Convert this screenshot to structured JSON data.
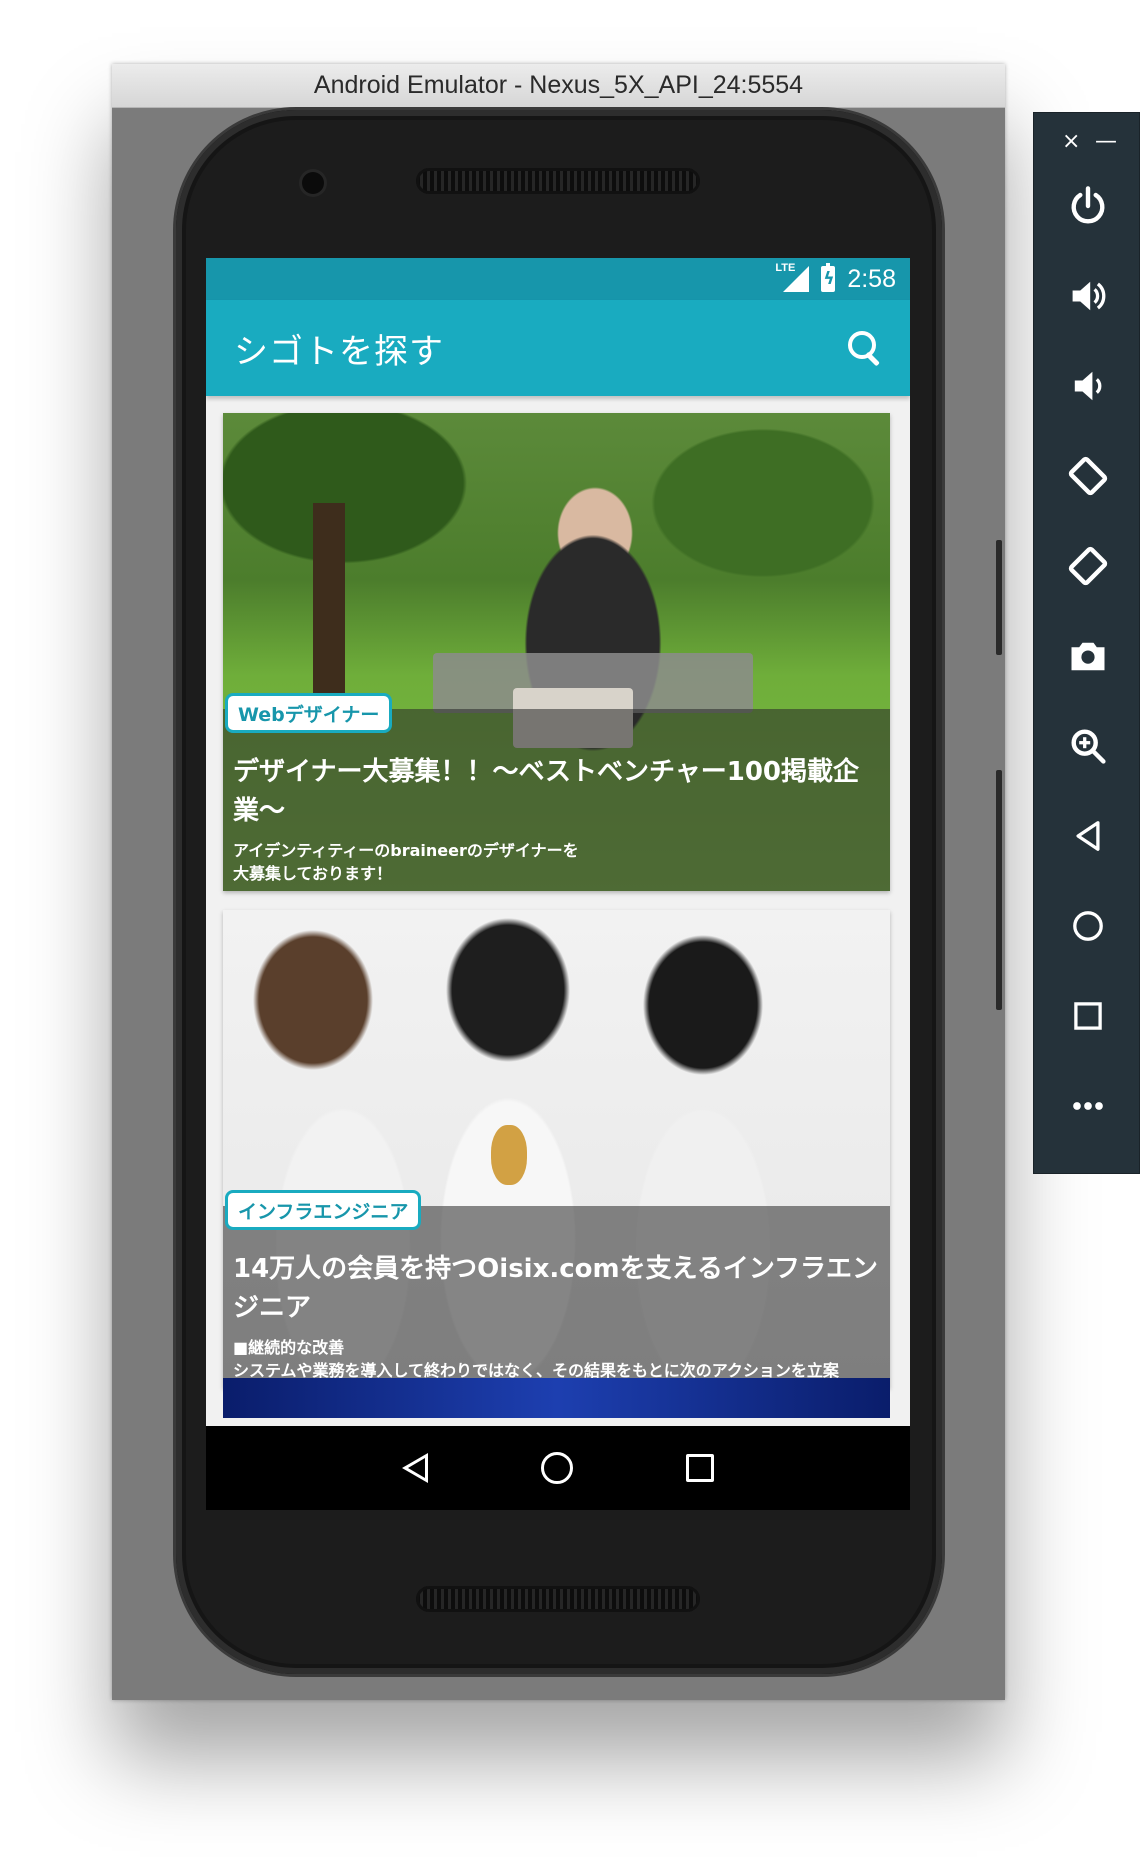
{
  "emulator": {
    "window_title": "Android Emulator - Nexus_5X_API_24:5554"
  },
  "status_bar": {
    "network": "LTE",
    "time": "2:58"
  },
  "app_bar": {
    "title": "シゴトを探す",
    "search_icon": "search-icon"
  },
  "jobs": [
    {
      "badge": "Webデザイナー",
      "title": "デザイナー大募集！！〜ベストベンチャー100掲載企業〜",
      "description": "アイデンティティーのbraineerのデザイナーを\n大募集しております！"
    },
    {
      "badge": "インフラエンジニア",
      "title": "14万人の会員を持つOisix.comを支えるインフラエンジニア",
      "description": "■継続的な改善\nシステムや業務を導入して終わりではなく、その結果をもとに次のアクションを立案"
    }
  ],
  "nav_bar": {
    "icons": [
      "back-icon",
      "home-icon",
      "recents-icon"
    ]
  },
  "toolbar": {
    "close": "×",
    "minimize": "—",
    "icons": [
      "power-icon",
      "volume-up-icon",
      "volume-down-icon",
      "rotate-left-icon",
      "rotate-right-icon",
      "camera-icon",
      "zoom-icon",
      "back-icon",
      "home-icon",
      "overview-icon",
      "more-icon"
    ]
  },
  "colors": {
    "status_bar": "#1796ab",
    "app_bar": "#19abc0",
    "toolbar_bg": "#25323a"
  }
}
